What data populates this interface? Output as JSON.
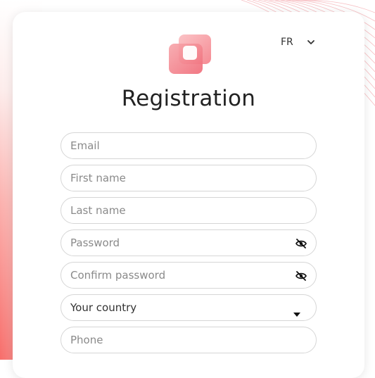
{
  "language": {
    "selected": "FR"
  },
  "form": {
    "title": "Registration",
    "email_placeholder": "Email",
    "first_name_placeholder": "First name",
    "last_name_placeholder": "Last name",
    "password_placeholder": "Password",
    "confirm_password_placeholder": "Confirm password",
    "country_value": "Your country",
    "phone_placeholder": "Phone"
  },
  "colors": {
    "accent": "#f48a8f",
    "accent_dark": "#f26d78",
    "bg_gradient_bottom": "#f76d6a"
  },
  "icons": {
    "logo": "stacked-squares-logo",
    "language_chevron": "chevron-down-icon",
    "password_toggle": "eye-slash-icon",
    "country_dropdown": "caret-down-icon"
  }
}
